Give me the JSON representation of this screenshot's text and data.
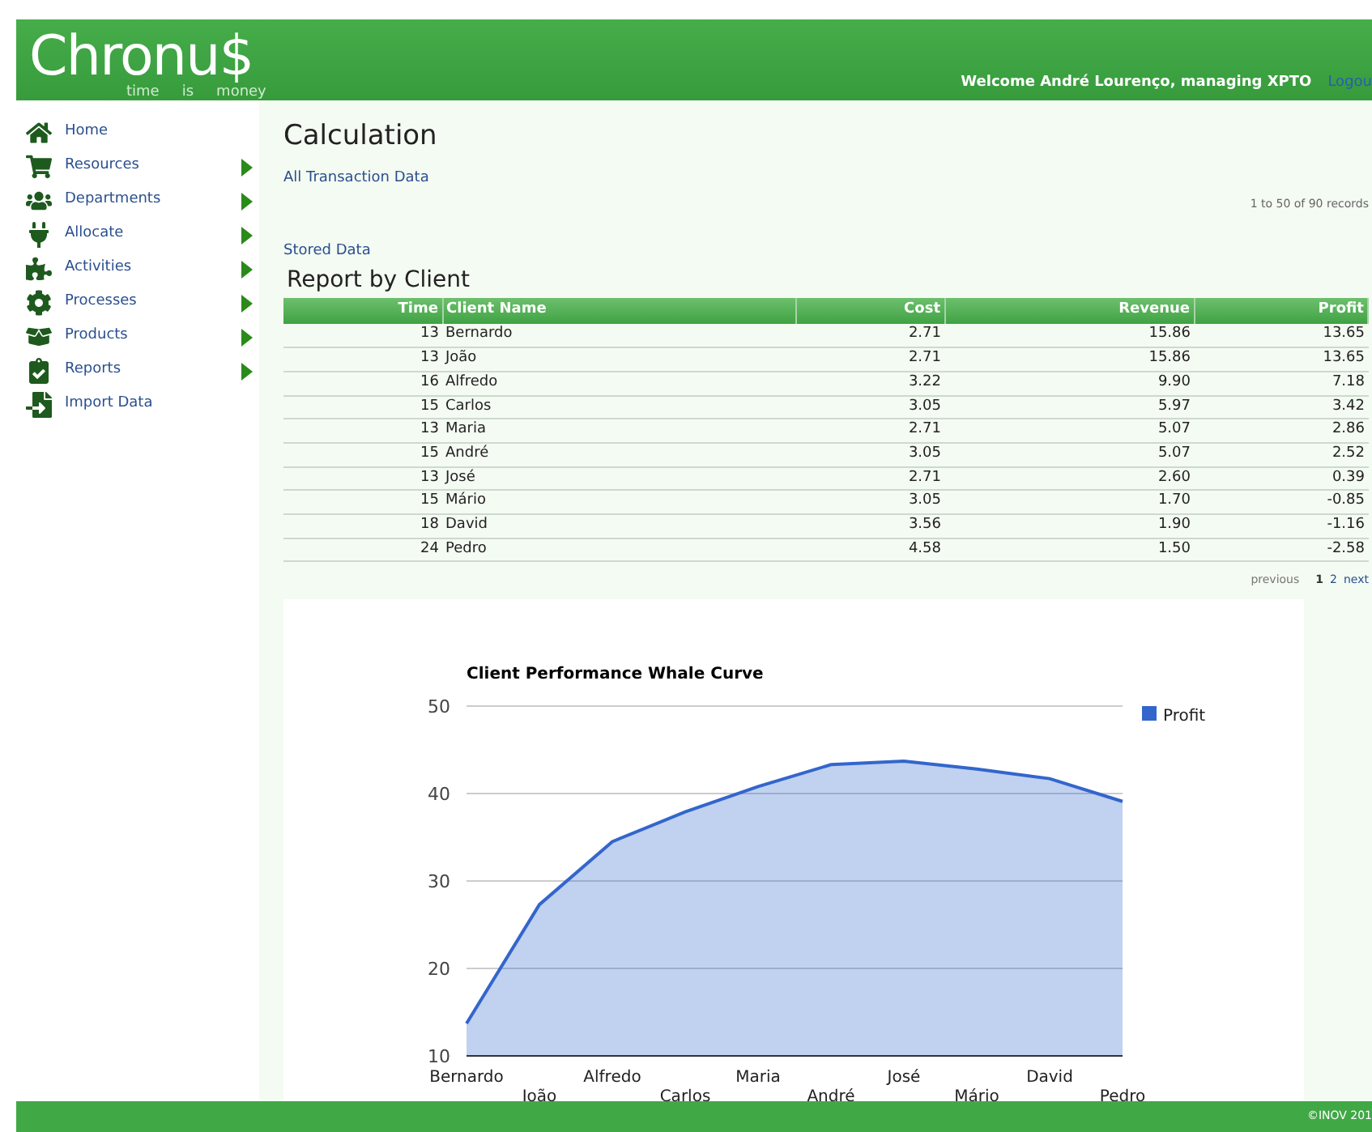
{
  "header": {
    "logo": "Chronu$",
    "tagline": [
      "time",
      "is",
      "money"
    ],
    "welcome": "Welcome André Lourenço, managing XPTO",
    "logout": "Logou"
  },
  "sidebar": {
    "items": [
      {
        "label": "Home",
        "submenu": false
      },
      {
        "label": "Resources",
        "submenu": true
      },
      {
        "label": "Departments",
        "submenu": true
      },
      {
        "label": "Allocate",
        "submenu": true
      },
      {
        "label": "Activities",
        "submenu": true
      },
      {
        "label": "Processes",
        "submenu": true
      },
      {
        "label": "Products",
        "submenu": true
      },
      {
        "label": "Reports",
        "submenu": true
      },
      {
        "label": "Import Data",
        "submenu": false
      }
    ]
  },
  "page": {
    "title": "Calculation",
    "link": "All Transaction Data",
    "records": "1 to 50 of 90 records",
    "stored_link": "Stored Data",
    "report_title": "Report by Client"
  },
  "table": {
    "columns": [
      "Time",
      "Client Name",
      "Cost",
      "Revenue",
      "Profit"
    ],
    "rows": [
      [
        "13",
        "Bernardo",
        "2.71",
        "15.86",
        "13.65"
      ],
      [
        "13",
        "João",
        "2.71",
        "15.86",
        "13.65"
      ],
      [
        "16",
        "Alfredo",
        "3.22",
        "9.90",
        "7.18"
      ],
      [
        "15",
        "Carlos",
        "3.05",
        "5.97",
        "3.42"
      ],
      [
        "13",
        "Maria",
        "2.71",
        "5.07",
        "2.86"
      ],
      [
        "15",
        "André",
        "3.05",
        "5.07",
        "2.52"
      ],
      [
        "13",
        "José",
        "2.71",
        "2.60",
        "0.39"
      ],
      [
        "15",
        "Mário",
        "3.05",
        "1.70",
        "-0.85"
      ],
      [
        "18",
        "David",
        "3.56",
        "1.90",
        "-1.16"
      ],
      [
        "24",
        "Pedro",
        "4.58",
        "1.50",
        "-2.58"
      ]
    ]
  },
  "pagination": {
    "previous": "previous",
    "pages": [
      {
        "label": "1",
        "selected": true
      },
      {
        "label": "2",
        "selected": false
      }
    ],
    "next": "next"
  },
  "chart_data": {
    "type": "area",
    "title": "Client Performance Whale Curve",
    "categories": [
      "Bernardo",
      "João",
      "Alfredo",
      "Carlos",
      "Maria",
      "André",
      "José",
      "Mário",
      "David",
      "Pedro"
    ],
    "series": [
      {
        "name": "Profit",
        "color": "#3366cc",
        "values": [
          13.7,
          27.3,
          34.5,
          37.9,
          40.8,
          43.3,
          43.7,
          42.8,
          41.7,
          39.1
        ]
      }
    ],
    "ylim": [
      10,
      50
    ],
    "yticks": [
      10,
      20,
      30,
      40,
      50
    ],
    "grid": true
  },
  "footer": {
    "copyright": "©INOV 201"
  }
}
